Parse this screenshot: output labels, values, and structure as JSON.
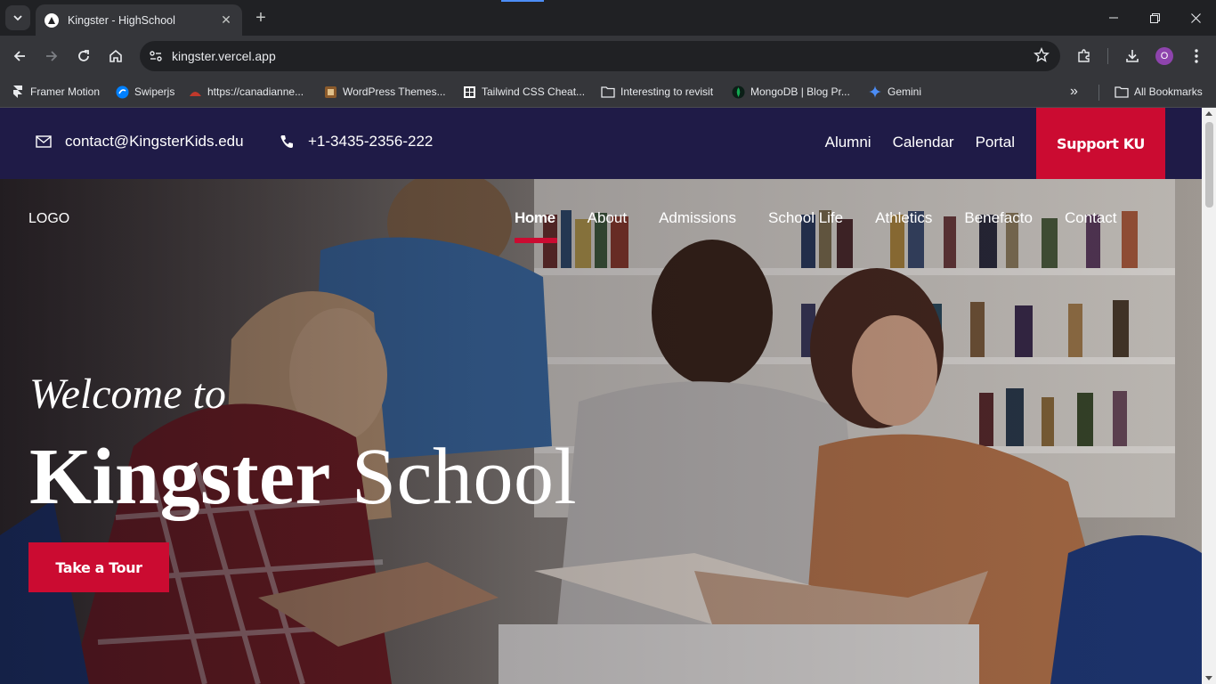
{
  "browser": {
    "tab": {
      "title": "Kingster - HighSchool"
    },
    "url": "kingster.vercel.app",
    "profile_initial": "O",
    "bookmarks": [
      {
        "label": "Framer Motion",
        "icon": "framer-icon"
      },
      {
        "label": "Swiperjs",
        "icon": "swiper-icon"
      },
      {
        "label": "https://canadianne...",
        "icon": "site-icon"
      },
      {
        "label": "WordPress Themes...",
        "icon": "wordpress-themes-icon"
      },
      {
        "label": "Tailwind CSS Cheat...",
        "icon": "tailwind-icon"
      },
      {
        "label": "Interesting to revisit",
        "icon": "folder-icon"
      },
      {
        "label": "MongoDB | Blog Pr...",
        "icon": "mongodb-icon"
      },
      {
        "label": "Gemini",
        "icon": "gemini-icon"
      }
    ],
    "all_bookmarks": "All Bookmarks"
  },
  "site": {
    "topbar": {
      "email": "contact@KingsterKids.edu",
      "phone": "+1-3435-2356-222",
      "links": [
        "Alumni",
        "Calendar",
        "Portal"
      ],
      "support_button": "Support KU"
    },
    "logo": "LOGO",
    "nav": [
      "Home",
      "About",
      "Admissions",
      "School Life",
      "Athletics",
      "Benefacto",
      "Contact"
    ],
    "active_nav": "Home",
    "hero": {
      "welcome": "Welcome to",
      "title_bold": "Kingster",
      "title_regular": "School",
      "cta": "Take a Tour"
    }
  },
  "colors": {
    "topbar_bg": "#1f1b47",
    "accent_red": "#cb0b31"
  }
}
